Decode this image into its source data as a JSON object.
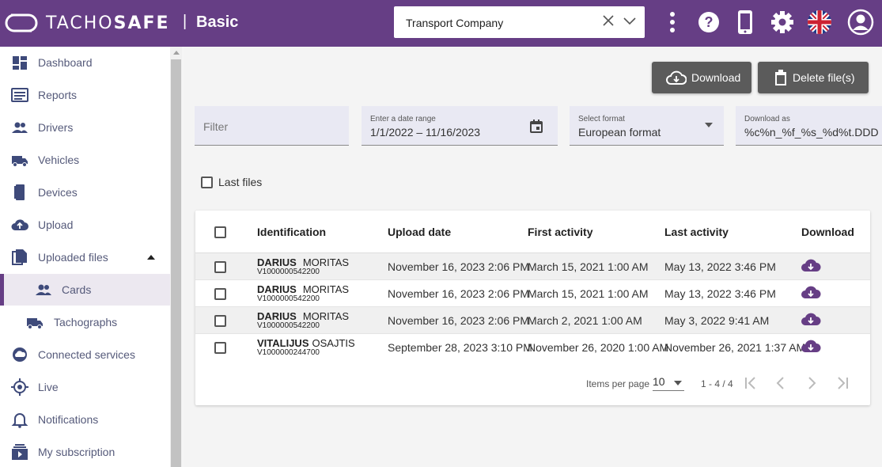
{
  "header": {
    "brand_light": "TACHO",
    "brand_bold": "SAFE",
    "separator": "|",
    "plan": "Basic",
    "company": "Transport Company",
    "icons": [
      "more-vert-icon",
      "help-icon",
      "phone-icon",
      "gear-icon",
      "uk-flag-icon",
      "account-icon"
    ],
    "accent": "#663e85"
  },
  "sidebar": {
    "items": [
      {
        "label": "Dashboard",
        "icon": "dashboard-icon"
      },
      {
        "label": "Reports",
        "icon": "reports-icon"
      },
      {
        "label": "Drivers",
        "icon": "drivers-icon"
      },
      {
        "label": "Vehicles",
        "icon": "truck-icon"
      },
      {
        "label": "Devices",
        "icon": "device-icon"
      },
      {
        "label": "Upload",
        "icon": "cloud-upload-icon"
      },
      {
        "label": "Uploaded files",
        "icon": "files-icon"
      },
      {
        "label": "Cards",
        "icon": "people-icon"
      },
      {
        "label": "Tachographs",
        "icon": "truck-icon"
      },
      {
        "label": "Connected services",
        "icon": "cloud-icon"
      },
      {
        "label": "Live",
        "icon": "target-icon"
      },
      {
        "label": "Notifications",
        "icon": "bell-icon"
      },
      {
        "label": "My subscription",
        "icon": "subscription-icon"
      }
    ]
  },
  "toolbar": {
    "download_label": "Download",
    "delete_label": "Delete file(s)"
  },
  "filters": {
    "filter_placeholder": "Filter",
    "date_label": "Enter a date range",
    "date_value": "1/1/2022 – 11/16/2023",
    "format_label": "Select format",
    "format_value": "European format",
    "download_as_label": "Download as",
    "download_as_value": "%c%n_%f_%s_%d%t.DDD"
  },
  "last_files_label": "Last files",
  "table": {
    "headers": {
      "identification": "Identification",
      "upload_date": "Upload date",
      "first_activity": "First activity",
      "last_activity": "Last activity",
      "download": "Download"
    },
    "rows": [
      {
        "first": "DARIUS",
        "last": "MORITAS",
        "card": "V1000000542200",
        "upload": "November 16, 2023 2:06 PM",
        "first_activity": "March 15, 2021 1:00 AM",
        "last_activity": "May 13, 2022 3:46 PM"
      },
      {
        "first": "DARIUS",
        "last": "MORITAS",
        "card": "V1000000542200",
        "upload": "November 16, 2023 2:06 PM",
        "first_activity": "March 15, 2021 1:00 AM",
        "last_activity": "May 13, 2022 3:46 PM"
      },
      {
        "first": "DARIUS",
        "last": "MORITAS",
        "card": "V1000000542200",
        "upload": "November 16, 2023 2:06 PM",
        "first_activity": "March 2, 2021 1:00 AM",
        "last_activity": "May 3, 2022 9:41 AM"
      },
      {
        "first": "VITALIJUS",
        "last": "OSAJTIS",
        "card": "V1000000244700",
        "upload": "September 28, 2023 3:10 PM",
        "first_activity": "November 26, 2020 1:00 AM",
        "last_activity": "November 26, 2021 1:37 AM"
      }
    ]
  },
  "pagination": {
    "items_per_page_label": "Items per page",
    "items_per_page": "10",
    "range": "1 - 4 / 4"
  }
}
